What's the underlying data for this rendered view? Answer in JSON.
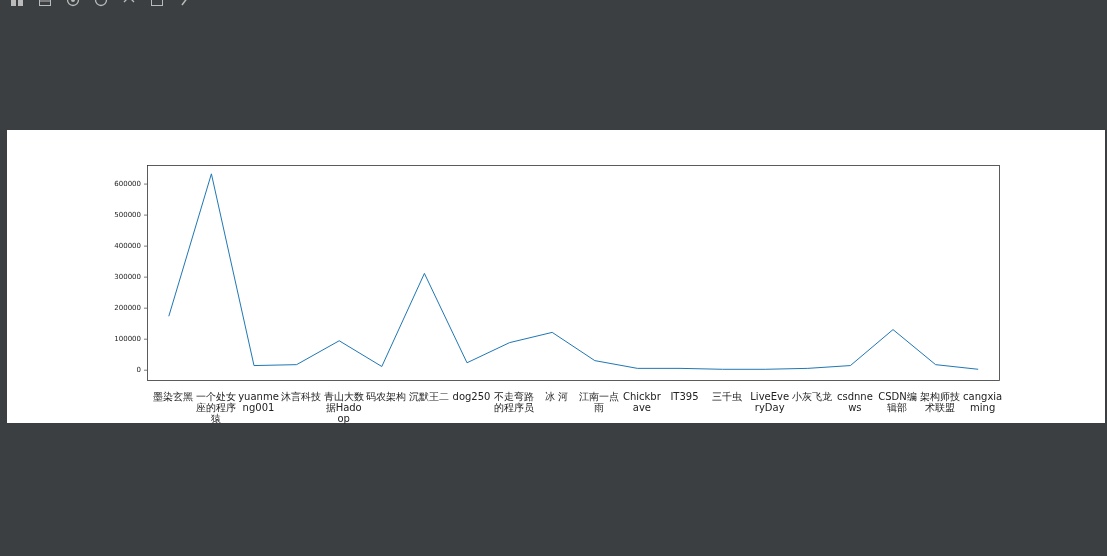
{
  "chart": {
    "chart_data": {
      "type": "line",
      "categories": [
        "墨染玄黑",
        "一个处女座的程序猿",
        "yuanmeng001",
        "沐言科技",
        "青山大数据Hadoop",
        "码农架构",
        "沉默王二",
        "dog250",
        "不走弯路的程序员",
        "冰 河",
        "江南一点雨",
        "Chickbrave",
        "IT395",
        "三千虫",
        "LiveEveryDay",
        "小灰飞龙",
        "csdnnews",
        "CSDN编辑部",
        "架构师技术联盟",
        "cangxiaming"
      ],
      "series": [
        {
          "color": "#1f77b4",
          "values": [
            174000,
            633000,
            15000,
            18000,
            95000,
            12000,
            312000,
            24000,
            89000,
            122000,
            31000,
            6000,
            6000,
            3000,
            3000,
            6000,
            15000,
            131000,
            18000,
            3000
          ]
        }
      ],
      "ylim": [
        -31500,
        661500
      ],
      "yticks": [
        0,
        {
          "value": 100000,
          "label": "100000"
        },
        {
          "value": 200000,
          "label": "200000"
        },
        {
          "value": 300000,
          "label": "300000"
        },
        {
          "value": 400000,
          "label": "400000"
        },
        {
          "value": 500000,
          "label": "500000"
        },
        {
          "value": 600000,
          "label": "600000"
        }
      ]
    }
  }
}
